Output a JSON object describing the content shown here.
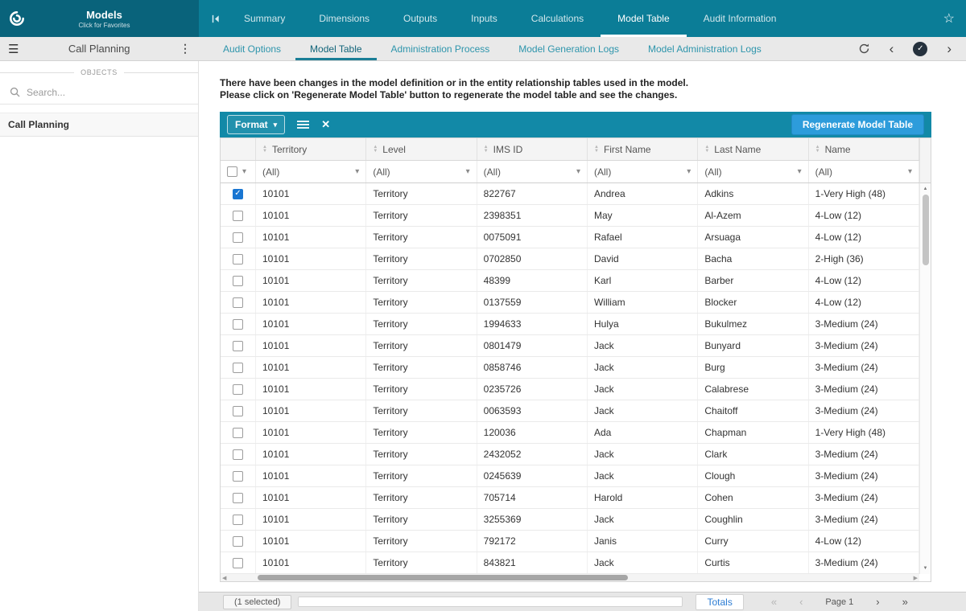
{
  "app": {
    "title": "Models",
    "subtitle": "Click for Favorites"
  },
  "top_nav": {
    "tabs": [
      {
        "label": "Summary",
        "active": false
      },
      {
        "label": "Dimensions",
        "active": false
      },
      {
        "label": "Outputs",
        "active": false
      },
      {
        "label": "Inputs",
        "active": false
      },
      {
        "label": "Calculations",
        "active": false
      },
      {
        "label": "Model Table",
        "active": true
      },
      {
        "label": "Audit Information",
        "active": false
      }
    ]
  },
  "sub_nav": {
    "tabs": [
      {
        "label": "Audit Options",
        "active": false
      },
      {
        "label": "Model Table",
        "active": true
      },
      {
        "label": "Administration Process",
        "active": false
      },
      {
        "label": "Model Generation Logs",
        "active": false
      },
      {
        "label": "Model Administration Logs",
        "active": false
      }
    ]
  },
  "sidebar": {
    "title": "Call Planning",
    "objects_label": "OBJECTS",
    "search_placeholder": "Search...",
    "items": [
      {
        "label": "Call Planning"
      }
    ]
  },
  "main": {
    "warning": {
      "line1": "There have been changes in the model definition or in the entity relationship tables used in the model.",
      "line2": "Please click on 'Regenerate Model Table' button to regenerate the model table and see the changes."
    },
    "toolbar": {
      "format_label": "Format",
      "regenerate_label": "Regenerate Model Table"
    },
    "table": {
      "columns": [
        "Territory",
        "Level",
        "IMS ID",
        "First Name",
        "Last Name",
        "Name"
      ],
      "filter_value": "(All)",
      "rows": [
        {
          "checked": true,
          "cells": [
            "10101",
            "Territory",
            "822767",
            "Andrea",
            "Adkins",
            "1-Very High (48)"
          ]
        },
        {
          "checked": false,
          "cells": [
            "10101",
            "Territory",
            "2398351",
            "May",
            "Al-Azem",
            "4-Low (12)"
          ]
        },
        {
          "checked": false,
          "cells": [
            "10101",
            "Territory",
            "0075091",
            "Rafael",
            "Arsuaga",
            "4-Low (12)"
          ]
        },
        {
          "checked": false,
          "cells": [
            "10101",
            "Territory",
            "0702850",
            "David",
            "Bacha",
            "2-High (36)"
          ]
        },
        {
          "checked": false,
          "cells": [
            "10101",
            "Territory",
            "48399",
            "Karl",
            "Barber",
            "4-Low (12)"
          ]
        },
        {
          "checked": false,
          "cells": [
            "10101",
            "Territory",
            "0137559",
            "William",
            "Blocker",
            "4-Low (12)"
          ]
        },
        {
          "checked": false,
          "cells": [
            "10101",
            "Territory",
            "1994633",
            "Hulya",
            "Bukulmez",
            "3-Medium (24)"
          ]
        },
        {
          "checked": false,
          "cells": [
            "10101",
            "Territory",
            "0801479",
            "Jack",
            "Bunyard",
            "3-Medium (24)"
          ]
        },
        {
          "checked": false,
          "cells": [
            "10101",
            "Territory",
            "0858746",
            "Jack",
            "Burg",
            "3-Medium (24)"
          ]
        },
        {
          "checked": false,
          "cells": [
            "10101",
            "Territory",
            "0235726",
            "Jack",
            "Calabrese",
            "3-Medium (24)"
          ]
        },
        {
          "checked": false,
          "cells": [
            "10101",
            "Territory",
            "0063593",
            "Jack",
            "Chaitoff",
            "3-Medium (24)"
          ]
        },
        {
          "checked": false,
          "cells": [
            "10101",
            "Territory",
            "120036",
            "Ada",
            "Chapman",
            "1-Very High (48)"
          ]
        },
        {
          "checked": false,
          "cells": [
            "10101",
            "Territory",
            "2432052",
            "Jack",
            "Clark",
            "3-Medium (24)"
          ]
        },
        {
          "checked": false,
          "cells": [
            "10101",
            "Territory",
            "0245639",
            "Jack",
            "Clough",
            "3-Medium (24)"
          ]
        },
        {
          "checked": false,
          "cells": [
            "10101",
            "Territory",
            "705714",
            "Harold",
            "Cohen",
            "3-Medium (24)"
          ]
        },
        {
          "checked": false,
          "cells": [
            "10101",
            "Territory",
            "3255369",
            "Jack",
            "Coughlin",
            "3-Medium (24)"
          ]
        },
        {
          "checked": false,
          "cells": [
            "10101",
            "Territory",
            "792172",
            "Janis",
            "Curry",
            "4-Low (12)"
          ]
        },
        {
          "checked": false,
          "cells": [
            "10101",
            "Territory",
            "843821",
            "Jack",
            "Curtis",
            "3-Medium (24)"
          ]
        }
      ]
    },
    "footer": {
      "selected_label": "(1 selected)",
      "totals_label": "Totals",
      "page_label": "Page 1"
    }
  },
  "colors": {
    "header_teal": "#0b7d97",
    "logo_teal": "#09637b",
    "toolbar_teal": "#1289a7",
    "accent_blue": "#2d9cdb",
    "checkbox_blue": "#1976d2",
    "link_blue": "#2b7cd3",
    "subnav_text": "#2e95ac"
  }
}
